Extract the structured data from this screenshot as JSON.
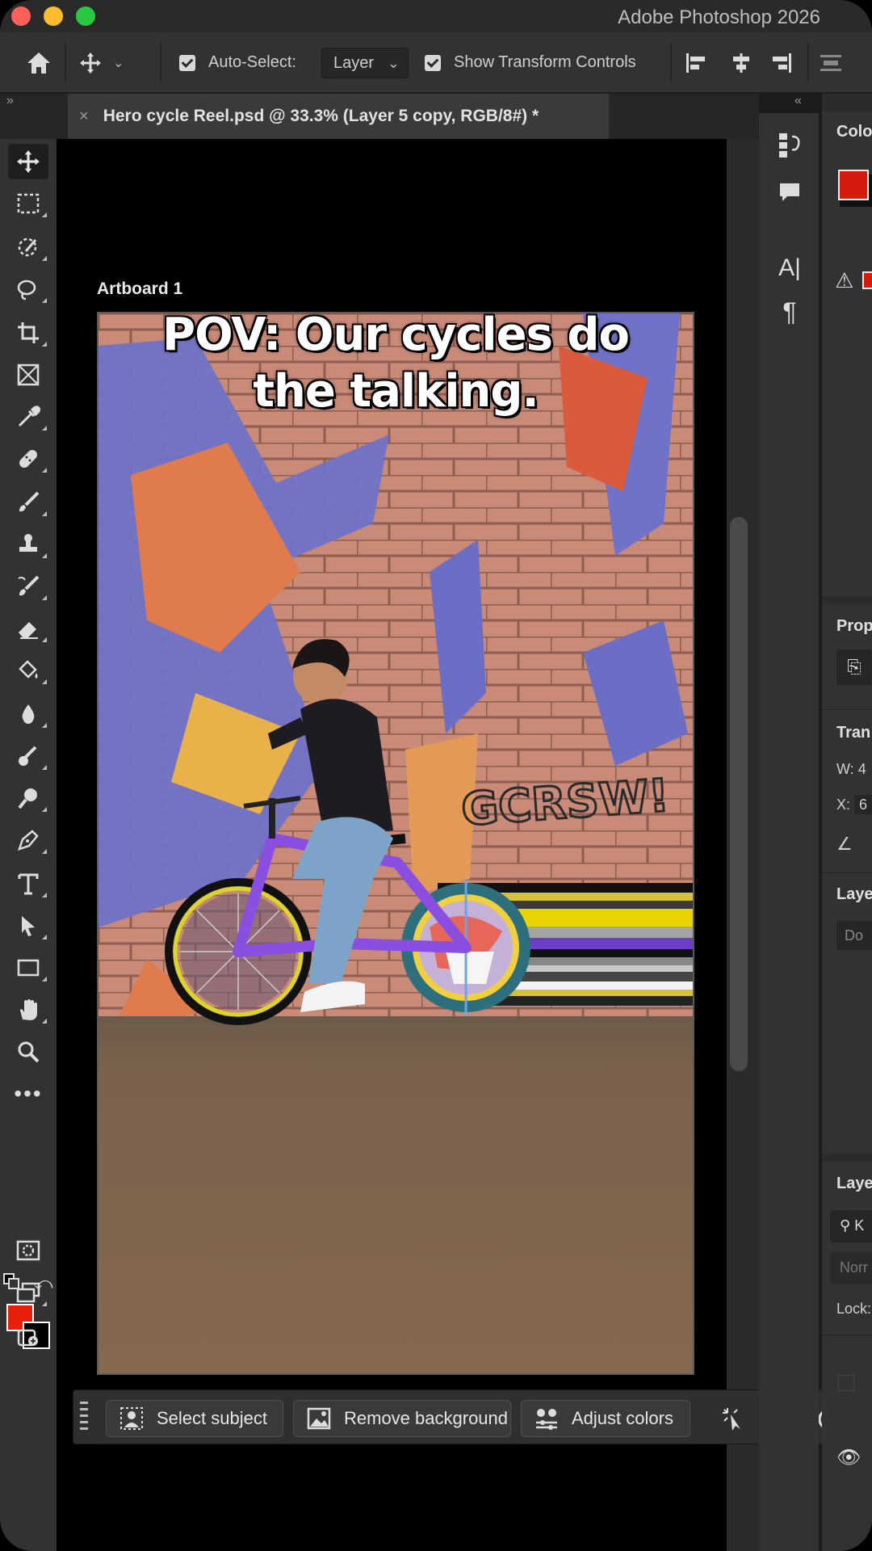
{
  "app": {
    "title": "Adobe Photoshop 2026"
  },
  "options_bar": {
    "auto_select_label": "Auto-Select:",
    "layer_select_value": "Layer",
    "show_transform_label": "Show Transform Controls"
  },
  "document": {
    "tab_title": "Hero cycle Reel.psd @ 33.3% (Layer 5 copy, RGB/8#) *",
    "artboard_label": "Artboard 1",
    "caption_line1": "POV: Our cycles do",
    "caption_line2": "the talking."
  },
  "task_bar": {
    "select_subject": "Select subject",
    "remove_background": "Remove background",
    "adjust_colors": "Adjust colors"
  },
  "right_panels": {
    "color_title": "Colo",
    "properties_title": "Prop",
    "transform_title": "Tran",
    "w_label": "W:",
    "w_value": "4",
    "x_label": "X:",
    "x_value": "6",
    "layer_title": "Laye",
    "layer_select": "Do",
    "layers_title": "Laye",
    "search_placeholder": "K",
    "blend_mode": "Norr",
    "lock_label": "Lock:"
  },
  "colors": {
    "foreground": "#e8200b",
    "background": "#000000",
    "accent": "#2680eb"
  },
  "icons": [
    "home-icon",
    "move-icon",
    "chevron-down-icon",
    "align-left-icon",
    "align-center-icon",
    "align-right-icon",
    "more-icon"
  ]
}
